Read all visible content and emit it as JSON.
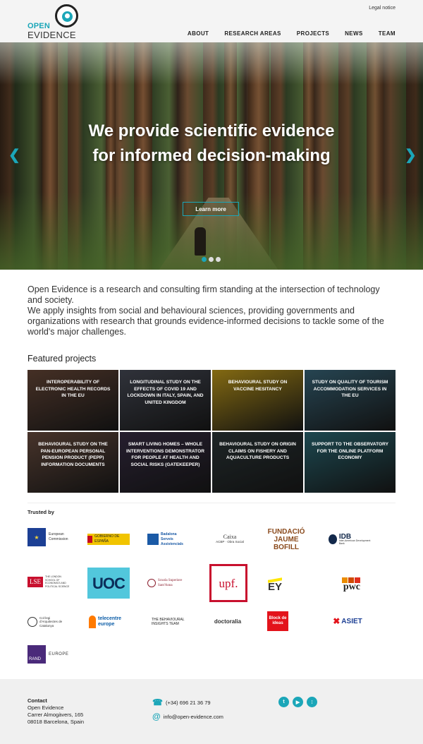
{
  "header": {
    "legal_notice": "Legal notice",
    "logo_open": "OPEN",
    "logo_evidence": "EVIDENCE",
    "nav": [
      "ABOUT",
      "RESEARCH AREAS",
      "PROJECTS",
      "NEWS",
      "TEAM"
    ]
  },
  "hero": {
    "title": "We provide scientific evidence for informed decision-making",
    "button": "Learn more",
    "slides_total": 3,
    "slide_active": 1
  },
  "intro": {
    "p1": "Open Evidence is a research and consulting firm standing at the intersection of technology and society.",
    "p2": "We apply insights from social and behavioural sciences, providing governments and organizations with research that grounds evidence-informed decisions to tackle some of the world's major challenges."
  },
  "featured": {
    "title": "Featured projects",
    "projects": [
      {
        "label": "INTEROPERABILITY OF ELECTRONIC HEALTH RECORDS IN THE EU",
        "color": "#6b4a3a"
      },
      {
        "label": "LONGITUDINAL STUDY ON THE EFFECTS OF COVID 19 AND LOCKDOWN IN ITALY, SPAIN, AND UNITED KINGDOM",
        "color": "#4a4e5a"
      },
      {
        "label": "BEHAVIOURAL STUDY ON VACCINE HESITANCY",
        "color": "#c9a21c"
      },
      {
        "label": "STUDY ON QUALITY OF TOURISM ACCOMMODATION SERVICES IN THE EU",
        "color": "#3b6a7e"
      },
      {
        "label": "BEHAVIOURAL STUDY ON THE PAN-EUROPEAN PERSONAL PENSION PRODUCT (PEPP) INFORMATION DOCUMENTS",
        "color": "#6e5042"
      },
      {
        "label": "SMART LIVING HOMES – WHOLE INTERVENTIONS DEMONSTRATOR FOR PEOPLE AT HEALTH AND SOCIAL RISKS (GATEKEEPER)",
        "color": "#3a2f48"
      },
      {
        "label": "BEHAVIOURAL STUDY ON ORIGIN CLAIMS ON FISHERY AND AQUACULTURE PRODUCTS",
        "color": "#2e3a3c"
      },
      {
        "label": "SUPPORT TO THE OBSERVATORY FOR THE ONLINE PLATFORM ECONOMY",
        "color": "#2c6e7a"
      }
    ]
  },
  "trusted": {
    "title": "Trusted by",
    "logos": {
      "european_commission": "European Commission",
      "gobierno": "GOBIERNO DE ESPAÑA",
      "badalona": "Badalona Serveis Assistencials",
      "caixa_top": "Caixa",
      "caixa_bottom": "ACBP · Obra Social",
      "jaume_bofill": "FUNDACIÓ JAUME BOFILL",
      "idb": "IDB",
      "idb_sub": "Inter-American Development Bank",
      "lse": "LSE",
      "lse_sub": "THE LONDON SCHOOL OF ECONOMICS AND POLITICAL SCIENCE",
      "uoc": "UOC",
      "sant_anna": "Scuola Superiore Sant'Anna",
      "upf": "upf.",
      "ey": "EY",
      "pwc": "pwc",
      "arquitectes": "Col·legi d'Arquitectes de Catalunya",
      "telecentre": "telecentre europe",
      "bit": "THE BEHAVIOURAL INSIGHTS TEAM",
      "doctoralia": "doctoralia",
      "block": "Block de ideas",
      "asiet": "ASIET",
      "rand": "RAND",
      "rand_sub": "EUROPE"
    }
  },
  "footer": {
    "contact_title": "Contact",
    "contact_name": "Open Evidence",
    "address1": "Carrer Almogàvers, 165",
    "address2": "08018 Barcelona, Spain",
    "phone": "(+34) 696 21 36 79",
    "email": "info@open-evidence.com",
    "socials": [
      "twitter-icon",
      "youtube-icon",
      "rss-icon"
    ]
  },
  "colors": {
    "accent": "#1ba6b8"
  }
}
